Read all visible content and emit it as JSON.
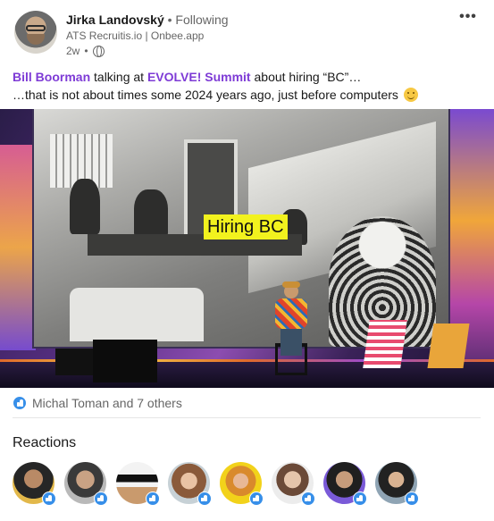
{
  "post": {
    "author": {
      "name": "Jirka Landovský",
      "follow_status": "Following",
      "headline": "ATS Recruitis.io | Onbee.app",
      "time": "2w"
    },
    "text": {
      "mention_person": "Bill Boorman",
      "part1": " talking at ",
      "mention_event": "EVOLVE! Summit",
      "part2": " about hiring “BC”…",
      "line2": "…that is not about times some 2024 years ago, just before computers"
    },
    "image": {
      "slide_label": "Hiring BC"
    }
  },
  "reactions": {
    "summary": "Michal Toman and 7 others",
    "title": "Reactions",
    "reactor_count": 8
  },
  "icons": {
    "more": "more-icon",
    "visibility": "globe-icon",
    "reaction": "like-icon",
    "emoji": "smile-emoji-icon"
  },
  "colors": {
    "mention": "#7e3bd6",
    "like": "#378fe9",
    "secondary_text": "#666666"
  }
}
